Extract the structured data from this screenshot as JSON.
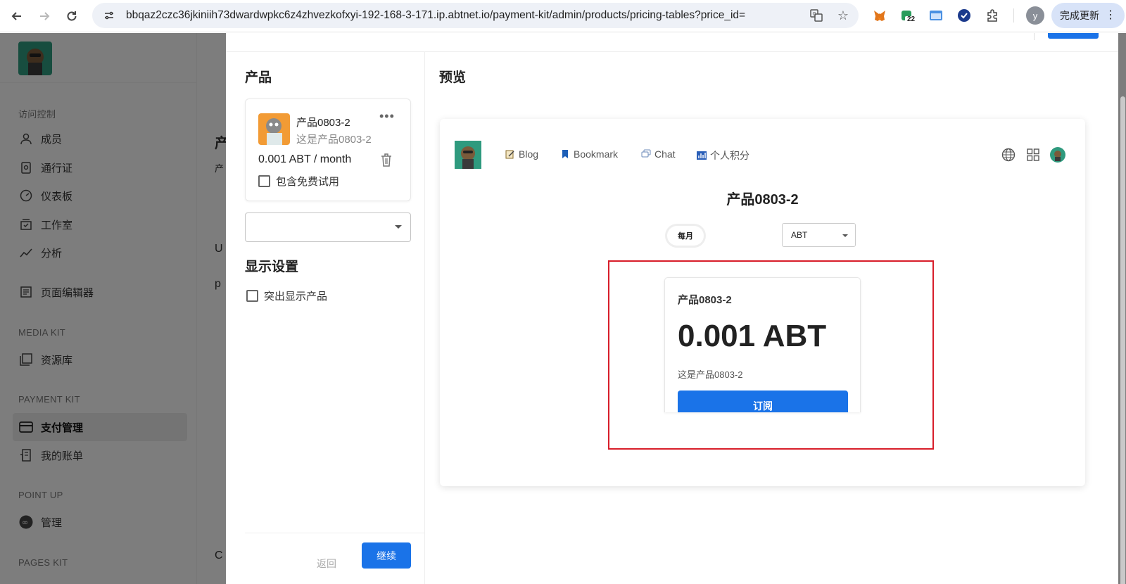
{
  "browser": {
    "url": "bbqaz2czc36jkiniih73dwardwpkc6z4zhvezkofxyi-192-168-3-171.ip.abtnet.io/payment-kit/admin/products/pricing-tables?price_id=",
    "extension_badge": "22",
    "profile_initial": "y",
    "update_label": "完成更新"
  },
  "sidebar": {
    "sections": [
      {
        "title": "访问控制"
      },
      {
        "title": "MEDIA KIT"
      },
      {
        "title": "PAYMENT KIT"
      },
      {
        "title": "POINT UP"
      },
      {
        "title": "PAGES KIT"
      }
    ],
    "items": [
      {
        "label": "成员"
      },
      {
        "label": "通行证"
      },
      {
        "label": "仪表板"
      },
      {
        "label": "工作室"
      },
      {
        "label": "分析"
      },
      {
        "label": "页面编辑器"
      },
      {
        "label": "资源库"
      },
      {
        "label": "支付管理"
      },
      {
        "label": "我的账单"
      },
      {
        "label": "管理"
      }
    ]
  },
  "background_main": {
    "fragments": [
      "产",
      "产",
      "U",
      "p",
      "C"
    ]
  },
  "dialog": {
    "products_heading": "产品",
    "product": {
      "name": "产品0803-2",
      "description": "这是产品0803-2",
      "price": "0.001 ABT / month",
      "free_trial_label": "包含免费试用"
    },
    "add_product_select_value": "",
    "display_heading": "显示设置",
    "highlight_label": "突出显示产品",
    "back_label": "返回",
    "continue_label": "继续",
    "preview_heading": "预览",
    "preview": {
      "nav": [
        {
          "label": "Blog"
        },
        {
          "label": "Bookmark"
        },
        {
          "label": "Chat"
        },
        {
          "label": "个人积分"
        }
      ],
      "title": "产品0803-2",
      "interval_label": "每月",
      "currency_value": "ABT",
      "card": {
        "name": "产品0803-2",
        "price": "0.001 ABT",
        "description": "这是产品0803-2",
        "button_label": "订阅"
      }
    }
  },
  "colors": {
    "primary": "#1a73e8",
    "highlight_border": "#d81e2a",
    "overlay": "rgba(0,0,0,0.5)"
  }
}
